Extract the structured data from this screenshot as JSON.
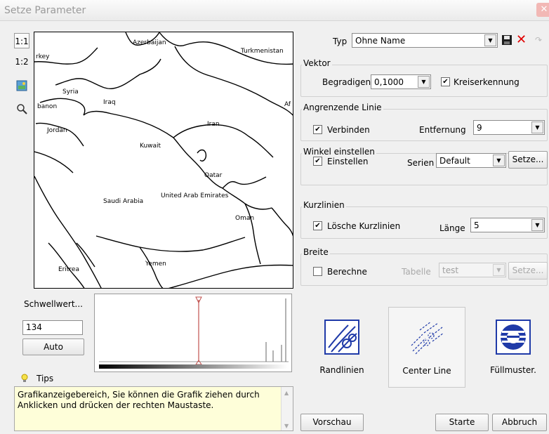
{
  "window": {
    "title": "Setze Parameter",
    "close_glyph": "✕"
  },
  "left_toolbar": {
    "zoom_1_1": "1:1",
    "zoom_1_2": "1:2"
  },
  "map": {
    "labels": [
      "rkey",
      "Azerbaijan",
      "Turkmenistan",
      "Syria",
      "Iraq",
      "banon",
      "Jordan",
      "Iran",
      "Af",
      "Kuwait",
      "Qatar",
      "Saudi Arabia",
      "United Arab Emirates",
      "Oman",
      "Eritrea",
      "Yemen"
    ]
  },
  "threshold": {
    "label": "Schwellwert...",
    "value": "134",
    "auto_button": "Auto"
  },
  "tips": {
    "label": "Tips",
    "text": "Grafikanzeigebereich, Sie können die Grafik ziehen durch Anklicken und drücken der rechten Maustaste."
  },
  "typ": {
    "label": "Typ",
    "value": "Ohne Name"
  },
  "vektor": {
    "title": "Vektor",
    "begradigen_label": "Begradigen",
    "begradigen_value": "0,1000",
    "kreiserkennung": "Kreiserkennung",
    "kreiserkennung_checked": true
  },
  "angrenzende": {
    "title": "Angrenzende Linie",
    "verbinden": "Verbinden",
    "verbinden_checked": true,
    "entfernung_label": "Entfernung",
    "entfernung_value": "9"
  },
  "winkel": {
    "title": "Winkel einstellen",
    "einstellen": "Einstellen",
    "einstellen_checked": true,
    "serien_label": "Serien",
    "serien_value": "Default",
    "setze": "Setze..."
  },
  "kurzlinien": {
    "title": "Kurzlinien",
    "loesche": "Lösche Kurzlinien",
    "loesche_checked": true,
    "laenge_label": "Länge",
    "laenge_value": "5"
  },
  "breite": {
    "title": "Breite",
    "berechne": "Berechne",
    "berechne_checked": false,
    "tabelle_label": "Tabelle",
    "tabelle_value": "test",
    "setze": "Setze..."
  },
  "modes": {
    "randlinien": "Randlinien",
    "center_line": "Center Line",
    "fuellmuster": "Füllmuster."
  },
  "buttons": {
    "vorschau": "Vorschau",
    "starte": "Starte",
    "abbruch": "Abbruch"
  },
  "colors": {
    "threshold_marker": "#c0504d",
    "tips_bg": "#fefed9",
    "pattern_blue": "#1f3aa8",
    "delete_red": "#e00000"
  }
}
